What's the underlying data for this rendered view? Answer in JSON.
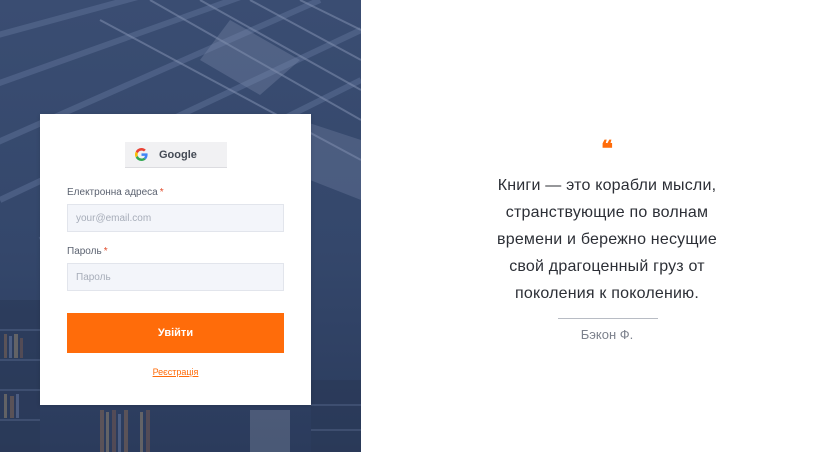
{
  "colors": {
    "accent": "#ff6c0a",
    "panel_bg": "#34476b"
  },
  "login": {
    "google_button": {
      "label": "Google",
      "icon": "google-icon"
    },
    "email": {
      "label": "Електронна адреса",
      "required_mark": "*",
      "placeholder": "your@email.com",
      "value": ""
    },
    "password": {
      "label": "Пароль",
      "required_mark": "*",
      "placeholder": "Пароль",
      "value": ""
    },
    "submit_label": "Увійти",
    "register_label": "Реєстрація"
  },
  "quote": {
    "mark": "❝",
    "lines": [
      "Книги — это корабли мысли,",
      "странствующие по волнам",
      "времени и бережно несущие",
      "свой драгоценный груз от",
      "поколения к поколению."
    ],
    "author": "Бэкон Ф."
  }
}
